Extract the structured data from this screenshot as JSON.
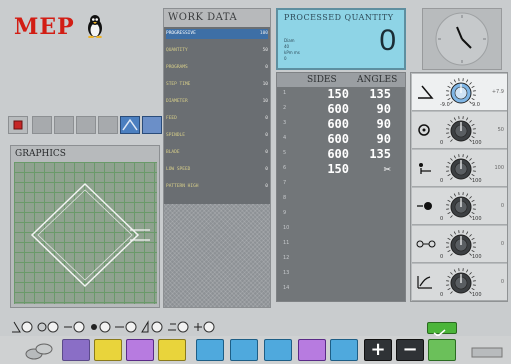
{
  "logo": {
    "text": "MEP"
  },
  "work_data": {
    "title": "WORK DATA",
    "rows": [
      {
        "label": "PROGRESSIVE",
        "value": "100"
      },
      {
        "label": "QUANTITY",
        "value": "50"
      },
      {
        "label": "PROGRAMS",
        "value": "0"
      },
      {
        "label": "STEP TIME",
        "value": "10"
      },
      {
        "label": "DIAMETER",
        "value": "10"
      },
      {
        "label": "FEED",
        "value": "0"
      },
      {
        "label": "SPINDLE",
        "value": "0"
      },
      {
        "label": "BLADE",
        "value": "0"
      },
      {
        "label": "LOW SPEED",
        "value": "0"
      },
      {
        "label": "PATTERN HIGH",
        "value": "0"
      }
    ]
  },
  "processed": {
    "title": "PROCESSED QUANTITY",
    "value": "0",
    "sub1": "Diam",
    "sub2": "40",
    "sub3": "kPm ms",
    "sub4": "0"
  },
  "sides_angles": {
    "sides_header": "SIDES",
    "angles_header": "ANGLES",
    "rows": [
      {
        "n": "1",
        "side": "150",
        "angle": "135"
      },
      {
        "n": "2",
        "side": "600",
        "angle": "90"
      },
      {
        "n": "3",
        "side": "600",
        "angle": "90"
      },
      {
        "n": "4",
        "side": "600",
        "angle": "90"
      },
      {
        "n": "5",
        "side": "600",
        "angle": "135"
      },
      {
        "n": "6",
        "side": "150",
        "angle": "✂"
      },
      {
        "n": "7",
        "side": "",
        "angle": ""
      },
      {
        "n": "8",
        "side": "",
        "angle": ""
      },
      {
        "n": "9",
        "side": "",
        "angle": ""
      },
      {
        "n": "10",
        "side": "",
        "angle": ""
      },
      {
        "n": "11",
        "side": "",
        "angle": ""
      },
      {
        "n": "12",
        "side": "",
        "angle": ""
      },
      {
        "n": "13",
        "side": "",
        "angle": ""
      },
      {
        "n": "14",
        "side": "",
        "angle": ""
      }
    ]
  },
  "knobs": [
    {
      "icon": "bend-angle-icon",
      "min": "-9.0",
      "max": "9.0",
      "value": "+7.9"
    },
    {
      "icon": "wire-feed-icon",
      "min": "0",
      "max": "100",
      "value": "50"
    },
    {
      "icon": "bending-head-icon",
      "min": "0",
      "max": "100",
      "value": "100"
    },
    {
      "icon": "rotation-icon",
      "min": "0",
      "max": "100",
      "value": "0"
    },
    {
      "icon": "straightener-icon",
      "min": "0",
      "max": "100",
      "value": "0"
    },
    {
      "icon": "ramp-icon",
      "min": "0",
      "max": "100",
      "value": "0"
    }
  ],
  "graphics": {
    "title": "GRAPHICS"
  },
  "colors": {
    "accent": "#d21d14",
    "processed_bg": "#8ed4e6",
    "selected_row": "#3d6fa6"
  }
}
